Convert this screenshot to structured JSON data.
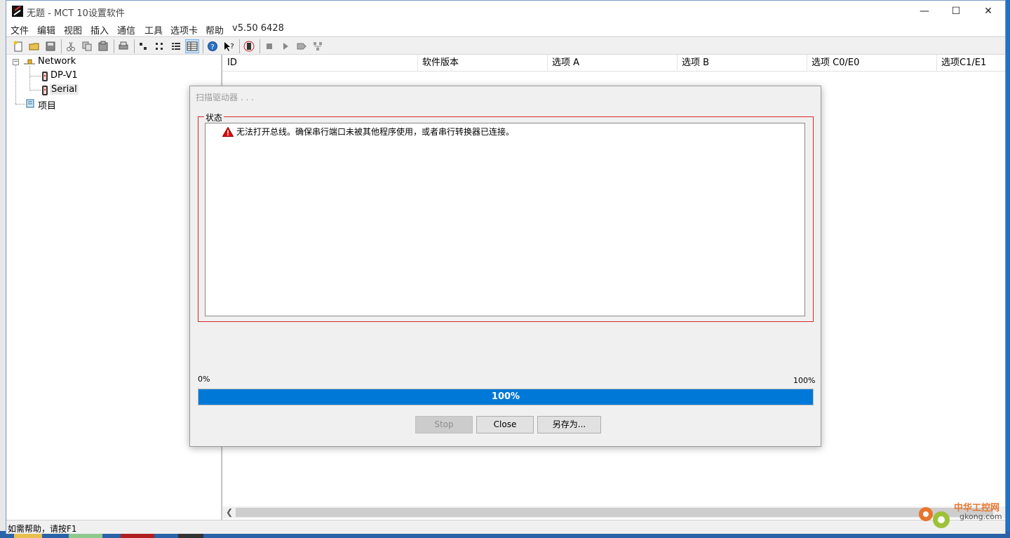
{
  "window": {
    "title": "无题 - MCT 10设置软件",
    "controls": {
      "minimize": "—",
      "maximize": "☐",
      "close": "✕"
    }
  },
  "menu": {
    "items": [
      "文件",
      "编辑",
      "视图",
      "插入",
      "通信",
      "工具",
      "选项卡",
      "帮助"
    ],
    "version": "v5.50 6428"
  },
  "toolbar": {
    "icons": [
      "new-file-icon",
      "open-folder-icon",
      "save-icon",
      "cut-icon",
      "copy-icon",
      "paste-icon",
      "print-icon",
      "large-icons-view-icon",
      "small-icons-view-icon",
      "list-view-icon",
      "details-view-icon",
      "help-icon",
      "context-help-icon",
      "drive-icon",
      "stop-icon",
      "play-icon",
      "tag-icon",
      "network-icon"
    ]
  },
  "tree": {
    "root": "Network",
    "children": [
      "DP-V1",
      "Serial"
    ],
    "project": "项目"
  },
  "list": {
    "columns": [
      "ID",
      "软件版本",
      "选项 A",
      "选项 B",
      "选项 C0/E0",
      "选项C1/E1"
    ]
  },
  "status_bar": {
    "text": "如需帮助，请按F1"
  },
  "dialog": {
    "title": "扫描驱动器 . . .",
    "group_label": "状态",
    "messages": [
      "无法打开总线。确保串行端口未被其他程序使用，或者串行转换器已连接。"
    ],
    "progress": {
      "value": 1.0,
      "label": "100%",
      "min_label": "0%",
      "max_label": "100%"
    },
    "buttons": {
      "stop": "Stop",
      "close": "Close",
      "save_as": "另存为..."
    }
  },
  "watermark": {
    "line1": "中华工控网",
    "line2": "gkong.com"
  },
  "colors": {
    "accent": "#0078d7",
    "group_border": "#d62828",
    "warning": "#d11"
  }
}
